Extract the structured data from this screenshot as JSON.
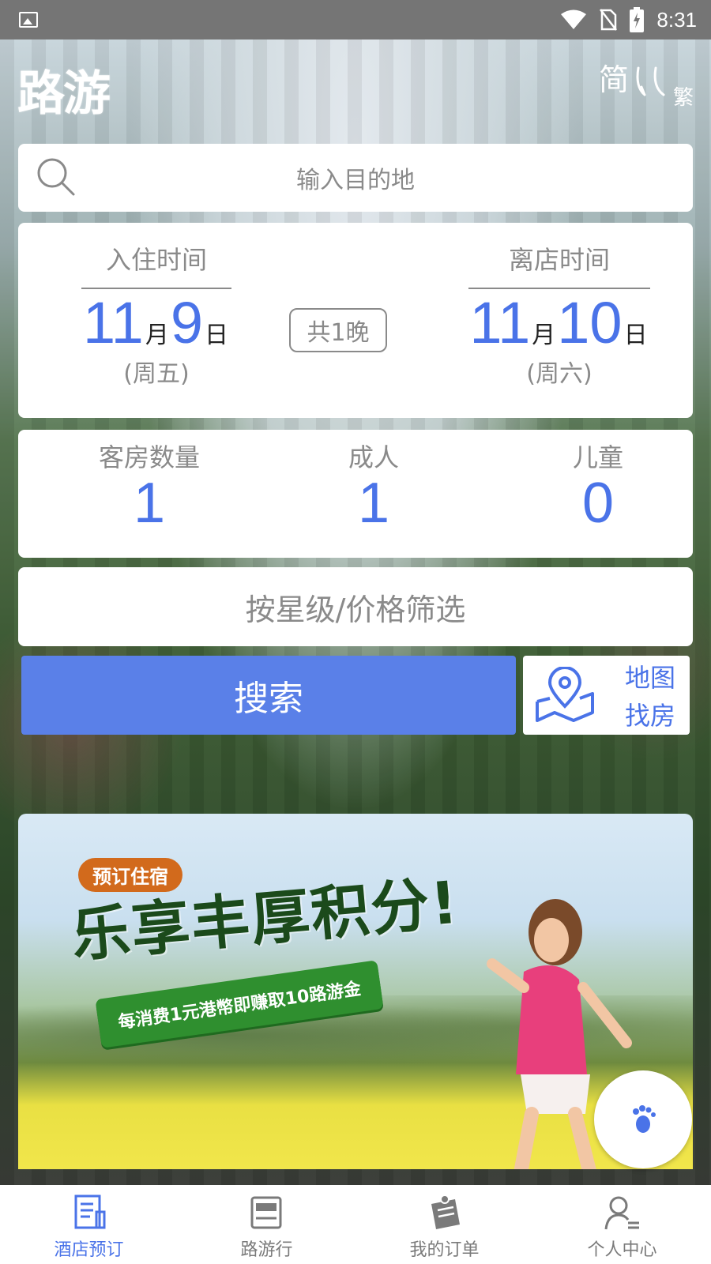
{
  "status_bar": {
    "time": "8:31",
    "icons": [
      "gallery-icon",
      "wifi-icon",
      "no-sim-icon",
      "battery-charging-icon"
    ]
  },
  "header": {
    "logo": "路游",
    "lang_simplified": "简",
    "lang_traditional": "繁"
  },
  "search": {
    "placeholder": "输入目的地",
    "icon": "search-icon"
  },
  "dates": {
    "checkin_label": "入住时间",
    "checkin_month": "11",
    "checkin_day": "9",
    "checkin_weekday": "(周五)",
    "checkout_label": "离店时间",
    "checkout_month": "11",
    "checkout_day": "10",
    "checkout_weekday": "(周六)",
    "month_unit": "月",
    "day_unit": "日",
    "nights": "共1晚"
  },
  "guests": {
    "rooms_label": "客房数量",
    "rooms_value": "1",
    "adults_label": "成人",
    "adults_value": "1",
    "children_label": "儿童",
    "children_value": "0"
  },
  "filter": {
    "label": "按星级/价格筛选"
  },
  "actions": {
    "search_label": "搜索",
    "map_line1": "地图",
    "map_line2": "找房"
  },
  "banner": {
    "tag": "预订住宿",
    "title": "乐享丰厚积分!",
    "ribbon": "每消费1元港幣即赚取10路游金"
  },
  "bottom_nav": {
    "items": [
      {
        "label": "酒店预订",
        "icon": "hotel-booking-icon",
        "active": true
      },
      {
        "label": "路游行",
        "icon": "luyou-travel-icon",
        "active": false
      },
      {
        "label": "我的订单",
        "icon": "orders-icon",
        "active": false
      },
      {
        "label": "个人中心",
        "icon": "profile-icon",
        "active": false
      }
    ]
  },
  "colors": {
    "accent": "#4a73e8",
    "button": "#5a80e8",
    "status_bar": "#757575",
    "muted_text": "#8a8a8a"
  }
}
